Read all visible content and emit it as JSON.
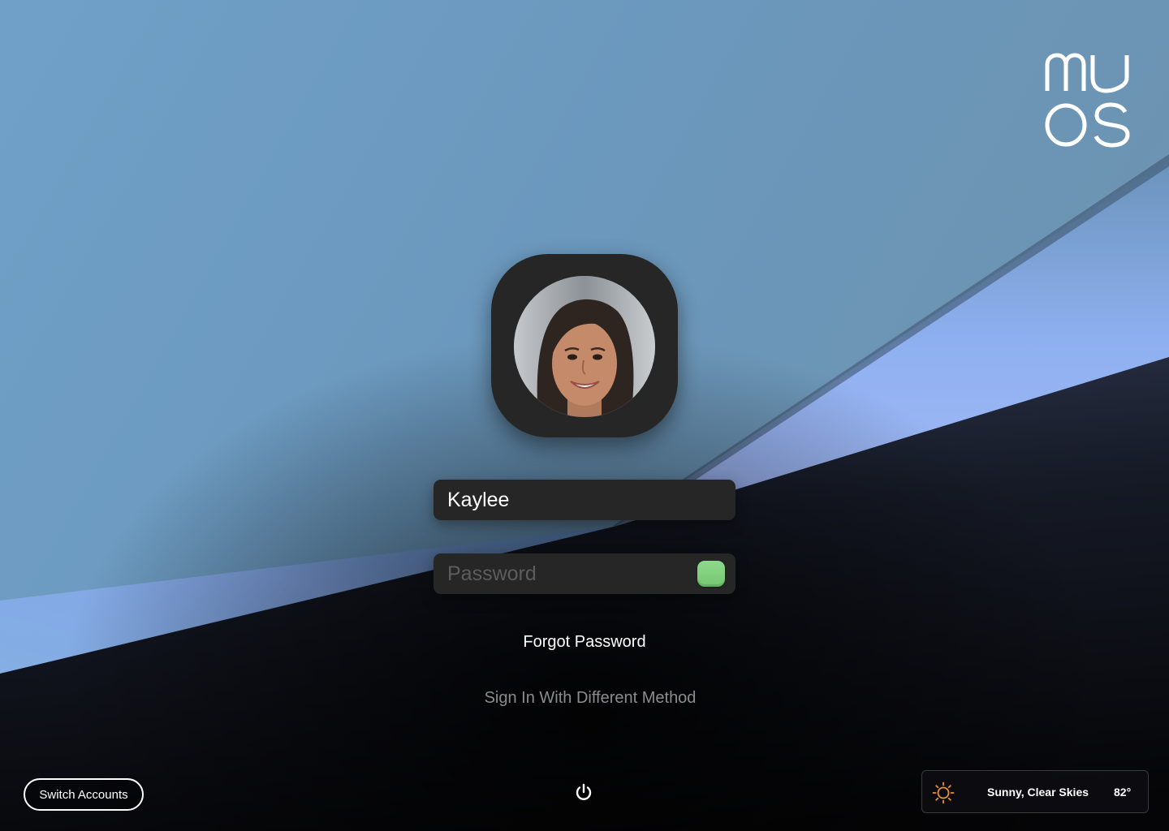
{
  "brand": {
    "logo_text_line1": "mu",
    "logo_text_line2": "OS"
  },
  "login": {
    "username": "Kaylee",
    "password_placeholder": "Password",
    "forgot_password_label": "Forgot Password",
    "alt_method_label": "Sign In With Different Method"
  },
  "footer": {
    "switch_accounts_label": "Switch Accounts",
    "power_icon": "power-icon"
  },
  "weather": {
    "icon": "sun-icon",
    "condition": "Sunny, Clear Skies",
    "temperature": "82°"
  },
  "colors": {
    "submit_button": "#80cf7c",
    "field_background": "#262626",
    "weather_icon": "#e9903b"
  }
}
